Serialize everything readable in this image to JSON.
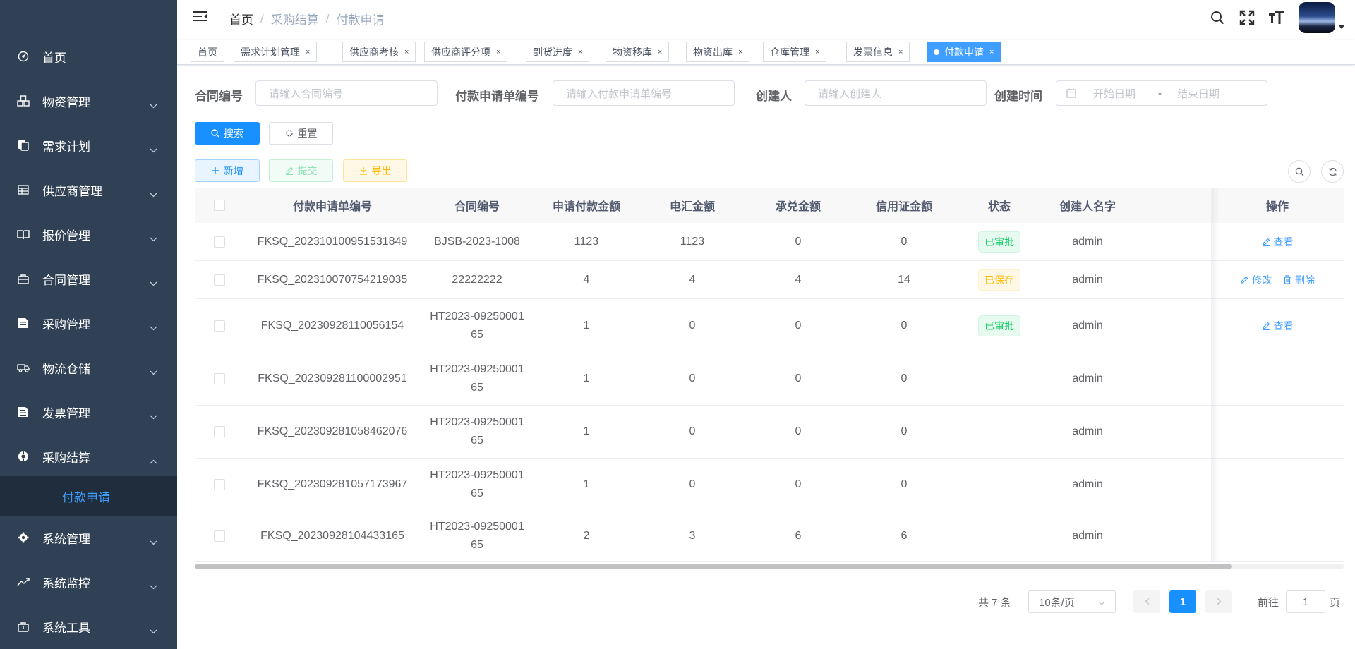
{
  "sidebar": {
    "items": [
      {
        "label": "首页",
        "icon": "dashboard-icon",
        "has_children": false
      },
      {
        "label": "物资管理",
        "icon": "cubes-icon",
        "has_children": true
      },
      {
        "label": "需求计划",
        "icon": "copy-icon",
        "has_children": true
      },
      {
        "label": "供应商管理",
        "icon": "table-icon",
        "has_children": true
      },
      {
        "label": "报价管理",
        "icon": "book-icon",
        "has_children": true
      },
      {
        "label": "合同管理",
        "icon": "briefcase-icon",
        "has_children": true
      },
      {
        "label": "采购管理",
        "icon": "document-icon",
        "has_children": true
      },
      {
        "label": "物流仓储",
        "icon": "truck-icon",
        "has_children": true
      },
      {
        "label": "发票管理",
        "icon": "invoice-icon",
        "has_children": true
      },
      {
        "label": "采购结算",
        "icon": "settle-icon",
        "has_children": true,
        "expanded": true
      },
      {
        "label": "系统管理",
        "icon": "gear-icon",
        "has_children": true
      },
      {
        "label": "系统监控",
        "icon": "monitor-icon",
        "has_children": true
      },
      {
        "label": "系统工具",
        "icon": "tool-icon",
        "has_children": true
      }
    ],
    "active_sub": "付款申请"
  },
  "header": {
    "breadcrumb": [
      "首页",
      "采购结算",
      "付款申请"
    ]
  },
  "tags": [
    {
      "label": "首页",
      "closable": false
    },
    {
      "label": "需求计划管理",
      "closable": true
    },
    {
      "label": "供应商考核",
      "closable": true
    },
    {
      "label": "供应商评分项",
      "closable": true
    },
    {
      "label": "到货进度",
      "closable": true
    },
    {
      "label": "物资移库",
      "closable": true
    },
    {
      "label": "物资出库",
      "closable": true
    },
    {
      "label": "仓库管理",
      "closable": true
    },
    {
      "label": "发票信息",
      "closable": true
    },
    {
      "label": "付款申请",
      "closable": true,
      "active": true
    }
  ],
  "search": {
    "contract_no_label": "合同编号",
    "contract_no_placeholder": "请输入合同编号",
    "apply_no_label": "付款申请单编号",
    "apply_no_placeholder": "请输入付款申请单编号",
    "creator_label": "创建人",
    "creator_placeholder": "请输入创建人",
    "create_time_label": "创建时间",
    "start_placeholder": "开始日期",
    "range_sep": "-",
    "end_placeholder": "结束日期",
    "search_btn": "搜索",
    "reset_btn": "重置"
  },
  "toolbar": {
    "add": "新增",
    "submit": "提交",
    "export": "导出"
  },
  "table": {
    "columns": [
      "付款申请单编号",
      "合同编号",
      "申请付款金额",
      "电汇金额",
      "承兑金额",
      "信用证金额",
      "状态",
      "创建人名字",
      "操作"
    ],
    "rows": [
      {
        "apply_no": "FKSQ_202310100951531849",
        "contract_no": "BJSB-2023-1008",
        "amount": "1123",
        "wire": "1123",
        "accept": "0",
        "lc": "0",
        "status": "已审批",
        "status_type": "ok",
        "creator": "admin",
        "ops": [
          "查看"
        ]
      },
      {
        "apply_no": "FKSQ_202310070754219035",
        "contract_no": "22222222",
        "amount": "4",
        "wire": "4",
        "accept": "4",
        "lc": "14",
        "status": "已保存",
        "status_type": "warn",
        "creator": "admin",
        "ops": [
          "修改",
          "删除"
        ]
      },
      {
        "apply_no": "FKSQ_20230928110056154",
        "contract_no": "HT2023-0925000165",
        "amount": "1",
        "wire": "0",
        "accept": "0",
        "lc": "0",
        "status": "已审批",
        "status_type": "ok",
        "creator": "admin",
        "ops": [
          "查看"
        ]
      },
      {
        "apply_no": "FKSQ_202309281100002951",
        "contract_no": "HT2023-0925000165",
        "amount": "1",
        "wire": "0",
        "accept": "0",
        "lc": "0",
        "status": "",
        "status_type": "",
        "creator": "admin",
        "ops": []
      },
      {
        "apply_no": "FKSQ_202309281058462076",
        "contract_no": "HT2023-0925000165",
        "amount": "1",
        "wire": "0",
        "accept": "0",
        "lc": "0",
        "status": "",
        "status_type": "",
        "creator": "admin",
        "ops": []
      },
      {
        "apply_no": "FKSQ_202309281057173967",
        "contract_no": "HT2023-0925000165",
        "amount": "1",
        "wire": "0",
        "accept": "0",
        "lc": "0",
        "status": "",
        "status_type": "",
        "creator": "admin",
        "ops": []
      },
      {
        "apply_no": "FKSQ_20230928104433165",
        "contract_no": "HT2023-0925000165",
        "amount": "2",
        "wire": "3",
        "accept": "6",
        "lc": "6",
        "status": "",
        "status_type": "",
        "creator": "admin",
        "ops": []
      }
    ]
  },
  "pagination": {
    "total_text": "共 7 条",
    "page_size": "10条/页",
    "current_page": "1",
    "goto_prefix": "前往",
    "goto_value": "1",
    "goto_suffix": "页"
  },
  "colors": {
    "sidebar_bg": "#304156",
    "primary": "#409eff",
    "success": "#13ce66",
    "warning": "#ffba00"
  }
}
